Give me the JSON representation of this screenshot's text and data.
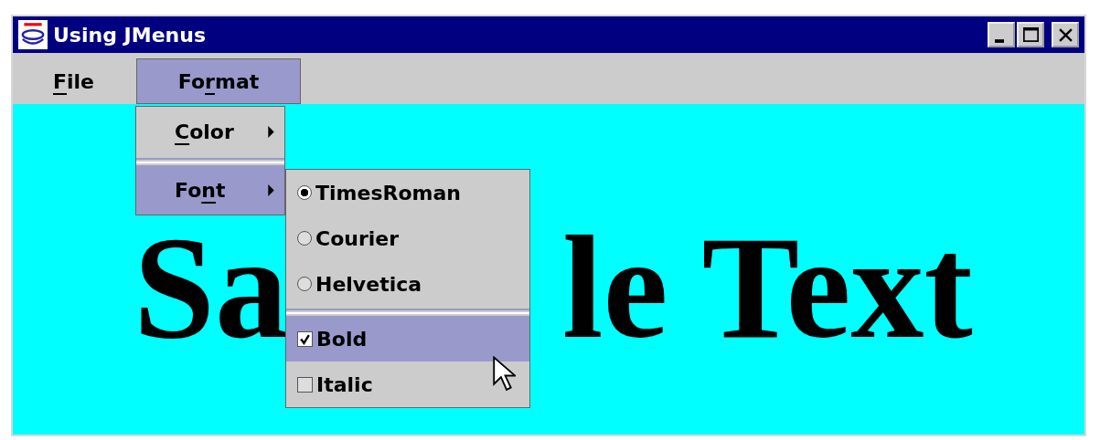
{
  "window": {
    "title": "Using JMenus",
    "controls": [
      {
        "kind": "minimize"
      },
      {
        "kind": "maximize"
      },
      {
        "kind": "close"
      }
    ]
  },
  "menubar": [
    {
      "key": "F",
      "after": "ile",
      "selected": false
    },
    {
      "before": "Fo",
      "key": "r",
      "after": "mat",
      "selected": true
    }
  ],
  "format_menu": [
    {
      "key": "C",
      "after": "olor",
      "selected": false
    },
    {
      "before": "Fo",
      "key": "n",
      "after": "t",
      "selected": true
    }
  ],
  "font_menu": [
    {
      "kind": "radio",
      "label": "TimesRoman",
      "checked": true,
      "selected": false
    },
    {
      "kind": "radio",
      "label": "Courier",
      "checked": false,
      "selected": false
    },
    {
      "kind": "radio",
      "label": "Helvetica",
      "checked": false,
      "selected": false
    },
    {
      "kind": "separator"
    },
    {
      "kind": "check",
      "label": "Bold",
      "checked": true,
      "selected": true
    },
    {
      "kind": "check",
      "label": "Italic",
      "checked": false,
      "selected": false
    }
  ],
  "content": {
    "text_parts": [
      "Sa",
      "le Text"
    ]
  }
}
